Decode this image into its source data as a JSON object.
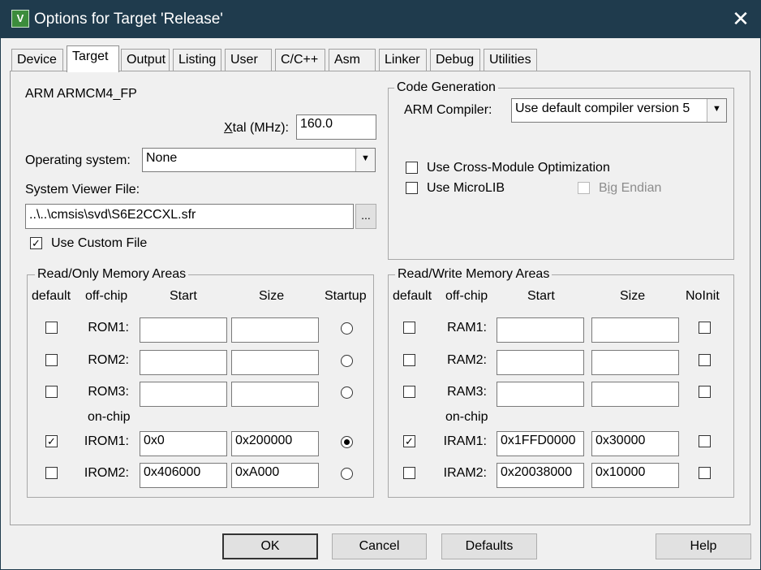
{
  "window": {
    "title": "Options for Target 'Release'",
    "icon": "keil-uvision-icon",
    "close_glyph": "✕"
  },
  "tabs": [
    {
      "label": "Device"
    },
    {
      "label": "Target",
      "active": true
    },
    {
      "label": "Output"
    },
    {
      "label": "Listing"
    },
    {
      "label": "User"
    },
    {
      "label": "C/C++"
    },
    {
      "label": "Asm"
    },
    {
      "label": "Linker"
    },
    {
      "label": "Debug"
    },
    {
      "label": "Utilities"
    }
  ],
  "target": {
    "device_name": "ARM ARMCM4_FP",
    "xtal_label_underlined": "X",
    "xtal_label_rest": "tal (MHz):",
    "xtal_value": "160.0",
    "os_label": "Operating system:",
    "os_value": "None",
    "svf_label": "System Viewer File:",
    "svf_value": "..\\..\\cmsis\\svd\\S6E2CCXL.sfr",
    "svf_browse": "...",
    "custom_file_label": "Use Custom File",
    "custom_file_checked": true
  },
  "code_generation": {
    "title": "Code Generation",
    "compiler_label": "ARM Compiler:",
    "compiler_value": "Use default compiler version 5",
    "cross_module_label": "Use Cross-Module Optimization",
    "cross_module_checked": false,
    "microlib_label": "Use MicroLIB",
    "microlib_checked": false,
    "big_endian_pre": "B",
    "big_endian_underlined": "i",
    "big_endian_post": "g Endian",
    "big_endian_checked": false
  },
  "ro_memory": {
    "title": "Read/Only Memory Areas",
    "headers": {
      "default": "default",
      "offchip": "off-chip",
      "start": "Start",
      "size": "Size",
      "startup": "Startup"
    },
    "onchip_label": "on-chip",
    "rows": [
      {
        "label": "ROM1:",
        "default": false,
        "start": "",
        "size": "",
        "startup": false
      },
      {
        "label": "ROM2:",
        "default": false,
        "start": "",
        "size": "",
        "startup": false
      },
      {
        "label": "ROM3:",
        "default": false,
        "start": "",
        "size": "",
        "startup": false
      },
      {
        "label": "IROM1:",
        "default": true,
        "start": "0x0",
        "size": "0x200000",
        "startup": true
      },
      {
        "label": "IROM2:",
        "default": false,
        "start": "0x406000",
        "size": "0xA000",
        "startup": false
      }
    ]
  },
  "rw_memory": {
    "title": "Read/Write Memory Areas",
    "headers": {
      "default": "default",
      "offchip": "off-chip",
      "start": "Start",
      "size": "Size",
      "noinit": "NoInit"
    },
    "onchip_label": "on-chip",
    "rows": [
      {
        "label": "RAM1:",
        "default": false,
        "start": "",
        "size": "",
        "noinit": false
      },
      {
        "label": "RAM2:",
        "default": false,
        "start": "",
        "size": "",
        "noinit": false
      },
      {
        "label": "RAM3:",
        "default": false,
        "start": "",
        "size": "",
        "noinit": false
      },
      {
        "label": "IRAM1:",
        "default": true,
        "start": "0x1FFD0000",
        "size": "0x30000",
        "noinit": false
      },
      {
        "label": "IRAM2:",
        "default": false,
        "start": "0x20038000",
        "size": "0x10000",
        "noinit": false
      }
    ]
  },
  "buttons": {
    "ok": "OK",
    "cancel": "Cancel",
    "defaults": "Defaults",
    "help": "Help"
  },
  "check_glyph": "✓",
  "combo_arrow_glyph": "▼"
}
